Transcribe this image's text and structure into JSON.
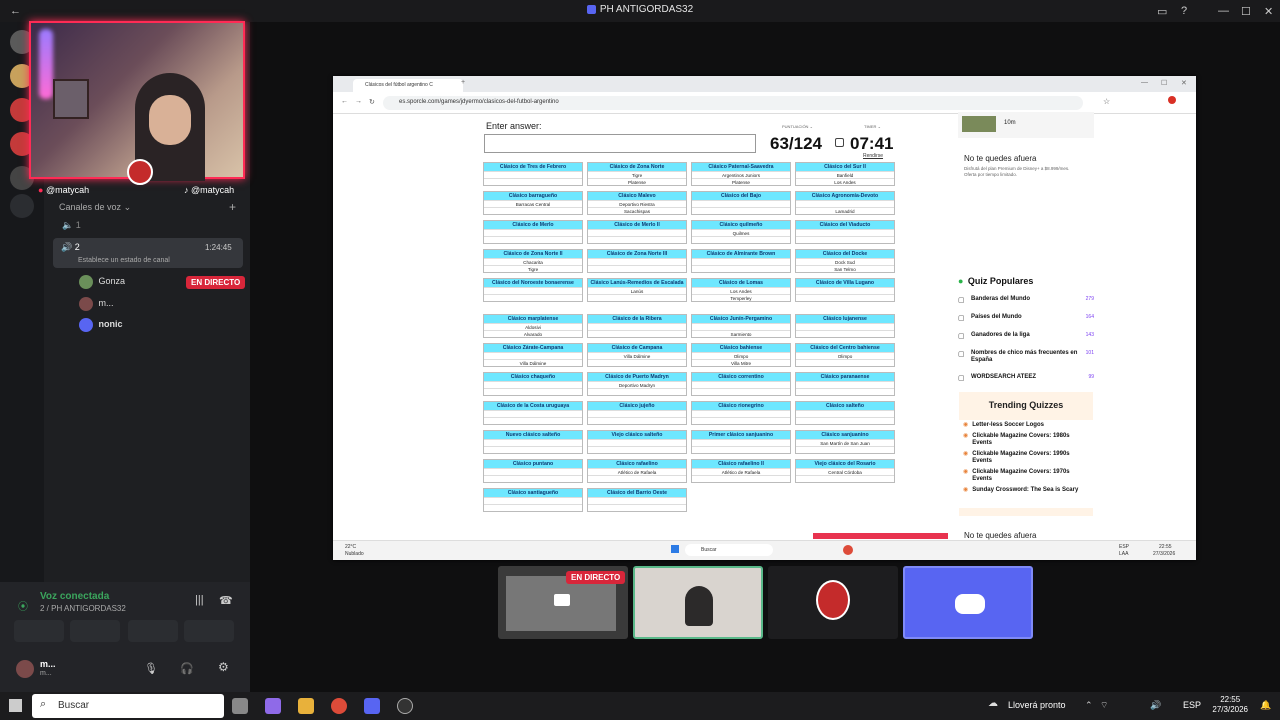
{
  "window": {
    "title": "PH ANTIGORDAS32"
  },
  "discord": {
    "handle_left": "@matycah",
    "handle_right": "@matycah",
    "voice_section": "Canales de voz",
    "channel_1": "1",
    "channel_2": "2",
    "channel_2_time": "1:24:45",
    "channel_status": "Establece un estado de canal",
    "members": [
      {
        "name": "Gonza",
        "badge": "EN DIRECTO"
      },
      {
        "name": "m..."
      },
      {
        "name": "nonic"
      }
    ],
    "vc_status": "Voz conectada",
    "vc_channel": "2 / PH ANTIGORDAS32",
    "user_short": "m...",
    "user_sub": "m..."
  },
  "browser": {
    "tab_title": "Clásicos del fútbol argentino C",
    "url": "es.sporcle.com/games/jdyermo/clasicos-del-futbol-argentino"
  },
  "quiz": {
    "enter_answer": "Enter answer:",
    "puntuacion_label": "PUNTUACIÓN",
    "timer_label": "TIMER",
    "score": "63/124",
    "timer": "07:41",
    "rendirse": "Rendirse",
    "cells": [
      {
        "h": "Clásico de Tres de Febrero",
        "r": [
          "",
          ""
        ]
      },
      {
        "h": "Clásico de Zona Norte",
        "r": [
          "Tigre",
          "Platense"
        ]
      },
      {
        "h": "Clásico Paternal-Saavedra",
        "r": [
          "Argentinos Juniors",
          "Platense"
        ]
      },
      {
        "h": "Clásico del Sur II",
        "r": [
          "Banfield",
          "Los Andes"
        ]
      },
      {
        "h": "Clásico barragueño",
        "r": [
          "Barracas Central",
          ""
        ]
      },
      {
        "h": "Clásico Malevo",
        "r": [
          "Deportivo Riestra",
          "Sacachispas"
        ]
      },
      {
        "h": "Clásico del Bajo",
        "r": [
          "",
          ""
        ]
      },
      {
        "h": "Clásico Agronomía-Devoto",
        "r": [
          "",
          "Lamadrid"
        ]
      },
      {
        "h": "Clásico de Merlo",
        "r": [
          "",
          ""
        ]
      },
      {
        "h": "Clásico de Merlo II",
        "r": [
          "",
          ""
        ]
      },
      {
        "h": "Clásico quilmeño",
        "r": [
          "Quilmes",
          ""
        ]
      },
      {
        "h": "Clásico del Viaducto",
        "r": [
          "",
          ""
        ]
      },
      {
        "h": "Clásico de Zona Norte II",
        "r": [
          "Chacarita",
          "Tigre"
        ]
      },
      {
        "h": "Clásico de Zona Norte III",
        "r": [
          "",
          ""
        ]
      },
      {
        "h": "Clásico de Almirante Brown",
        "r": [
          "",
          ""
        ]
      },
      {
        "h": "Clásico del Docke",
        "r": [
          "Dock Sud",
          "San Telmo"
        ]
      },
      {
        "h": "Clásico del Noroeste bonaerense",
        "r": [
          "",
          ""
        ]
      },
      {
        "h": "Clásico Lanús-Remedios de Escalada",
        "r": [
          "Lanús",
          ""
        ]
      },
      {
        "h": "Clásico de Lomas",
        "r": [
          "Los Andes",
          "Temperley"
        ]
      },
      {
        "h": "Clásico de Villa Lugano",
        "r": [
          "",
          ""
        ]
      },
      {
        "h": "Clásico marplatense",
        "r": [
          "Aldosivi",
          "Alvarado"
        ]
      },
      {
        "h": "Clásico de la Ribera",
        "r": [
          "",
          ""
        ]
      },
      {
        "h": "Clásico Junín-Pergamino",
        "r": [
          "",
          "Sarmiento"
        ]
      },
      {
        "h": "Clásico lujanense",
        "r": [
          "",
          ""
        ]
      },
      {
        "h": "Clásico Zárate-Campana",
        "r": [
          "",
          "Villa Dálmine"
        ]
      },
      {
        "h": "Clásico de Campana",
        "r": [
          "Villa Dálmine",
          ""
        ]
      },
      {
        "h": "Clásico bahiense",
        "r": [
          "Olimpo",
          "Villa Mitre"
        ]
      },
      {
        "h": "Clásico del Centro bahiense",
        "r": [
          "Olimpo",
          ""
        ]
      },
      {
        "h": "Clásico chaqueño",
        "r": [
          "",
          ""
        ]
      },
      {
        "h": "Clásico de Puerto Madryn",
        "r": [
          "Deportivo Madryn",
          ""
        ]
      },
      {
        "h": "Clásico correntino",
        "r": [
          "",
          ""
        ]
      },
      {
        "h": "Clásico paranaense",
        "r": [
          "",
          ""
        ]
      },
      {
        "h": "Clásico de la Costa uruguaya",
        "r": [
          "",
          ""
        ]
      },
      {
        "h": "Clásico jujeño",
        "r": [
          "",
          ""
        ]
      },
      {
        "h": "Clásico rionegrino",
        "r": [
          "",
          ""
        ]
      },
      {
        "h": "Clásico salteño",
        "r": [
          "",
          ""
        ]
      },
      {
        "h": "Nuevo clásico salteño",
        "r": [
          "",
          ""
        ]
      },
      {
        "h": "Viejo clásico salteño",
        "r": [
          "",
          ""
        ]
      },
      {
        "h": "Primer clásico sanjuanino",
        "r": [
          "",
          ""
        ]
      },
      {
        "h": "Clásico sanjuanino",
        "r": [
          "San Martín de San Juan",
          ""
        ]
      },
      {
        "h": "Clásico puntano",
        "r": [
          "",
          ""
        ]
      },
      {
        "h": "Clásico rafaelino",
        "r": [
          "Atlético de Rafaela",
          ""
        ]
      },
      {
        "h": "Clásico rafaelino II",
        "r": [
          "Atlético de Rafaela",
          ""
        ]
      },
      {
        "h": "Viejo clásico del Rosario",
        "r": [
          "Central Córdoba",
          ""
        ]
      },
      {
        "h": "Clásico santiagueño",
        "r": [
          "",
          ""
        ]
      },
      {
        "h": "Clásico del Barrio Oeste",
        "r": [
          "",
          ""
        ]
      }
    ]
  },
  "sidebar_right": {
    "ad_duration": "10m",
    "ad_title": "No te quedes afuera",
    "ad_text": "Disfrutá del plan Premium de Disney+ a $8.999/mes. Oferta por tiempo limitado.",
    "popular_title": "Quiz Populares",
    "popular": [
      {
        "name": "Banderas del Mundo",
        "count": "279"
      },
      {
        "name": "Países del Mundo",
        "count": "164"
      },
      {
        "name": "Ganadores de la liga",
        "count": "143"
      },
      {
        "name": "Nombres de chico más frecuentes en España",
        "count": "101"
      },
      {
        "name": "WORDSEARCH ATEEZ",
        "count": "99"
      }
    ],
    "trending_title": "Trending Quizzes",
    "trending": [
      "Letter-less Soccer Logos",
      "Clickable Magazine Covers: 1980s Events",
      "Clickable Magazine Covers: 1990s Events",
      "Clickable Magazine Covers: 1970s Events",
      "Sunday Crossword: The Sea is Scary"
    ],
    "footer_ad": "No te quedes afuera"
  },
  "inner_taskbar": {
    "weather": "22°C",
    "weather_sub": "Nublado",
    "search": "Buscar",
    "lang": "ESP",
    "lang_sub": "LAA",
    "time": "22:55",
    "date": "27/3/2026"
  },
  "thumbs": {
    "live_badge": "EN DIRECTO"
  },
  "taskbar": {
    "search": "Buscar",
    "weather": "Lloverá pronto",
    "lang": "ESP",
    "time": "22:55",
    "date": "27/3/2026"
  }
}
